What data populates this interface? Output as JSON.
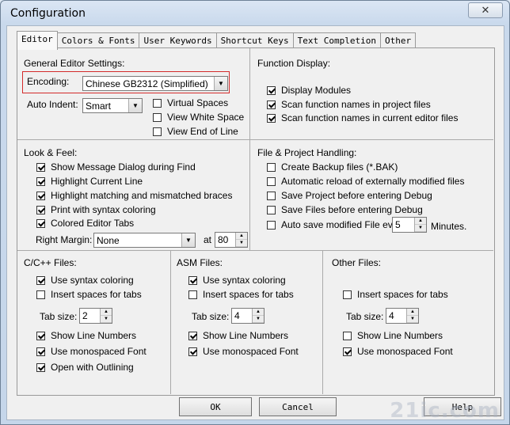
{
  "window": {
    "title": "Configuration",
    "close_label": "✕"
  },
  "tabs": [
    "Editor",
    "Colors & Fonts",
    "User Keywords",
    "Shortcut Keys",
    "Text Completion",
    "Other"
  ],
  "general": {
    "heading": "General Editor Settings:",
    "encoding_label": "Encoding:",
    "encoding_value": "Chinese GB2312 (Simplified)",
    "auto_indent_label": "Auto Indent:",
    "auto_indent_value": "Smart",
    "virtual_spaces": "Virtual Spaces",
    "view_white_space": "View White Space",
    "view_end_of_line": "View End of Line"
  },
  "function_display": {
    "heading": "Function Display:",
    "display_modules": "Display Modules",
    "scan_project": "Scan function names in project files",
    "scan_editor": "Scan function names in current editor files"
  },
  "look_feel": {
    "heading": "Look & Feel:",
    "show_message": "Show Message Dialog during Find",
    "highlight_line": "Highlight Current Line",
    "highlight_braces": "Highlight matching and mismatched braces",
    "print_syntax": "Print with syntax coloring",
    "colored_tabs": "Colored Editor Tabs",
    "right_margin_label": "Right Margin:",
    "right_margin_value": "None",
    "at_label": "at",
    "at_value": "80"
  },
  "file_project": {
    "heading": "File & Project Handling:",
    "backup": "Create Backup files (*.BAK)",
    "auto_reload": "Automatic reload of externally modified files",
    "save_project": "Save Project before entering Debug",
    "save_files": "Save Files before entering Debug",
    "auto_save": "Auto save modified File every",
    "auto_save_value": "5",
    "minutes": "Minutes."
  },
  "cpp": {
    "heading": "C/C++ Files:",
    "syntax": "Use syntax coloring",
    "insert_spaces": "Insert spaces for tabs",
    "tab_size_label": "Tab size:",
    "tab_size_value": "2",
    "line_numbers": "Show Line Numbers",
    "monospaced": "Use monospaced Font",
    "outlining": "Open with Outlining"
  },
  "asm": {
    "heading": "ASM Files:",
    "syntax": "Use syntax coloring",
    "insert_spaces": "Insert spaces for tabs",
    "tab_size_label": "Tab size:",
    "tab_size_value": "4",
    "line_numbers": "Show Line Numbers",
    "monospaced": "Use monospaced Font"
  },
  "other": {
    "heading": "Other Files:",
    "insert_spaces": "Insert spaces for tabs",
    "tab_size_label": "Tab size:",
    "tab_size_value": "4",
    "line_numbers": "Show Line Numbers",
    "monospaced": "Use monospaced Font"
  },
  "buttons": {
    "ok": "OK",
    "cancel": "Cancel",
    "help": "Help"
  },
  "watermark": "21ic.com",
  "colors": {
    "highlight_border": "#d32a2a",
    "panel_bg": "#f0f0f0"
  }
}
